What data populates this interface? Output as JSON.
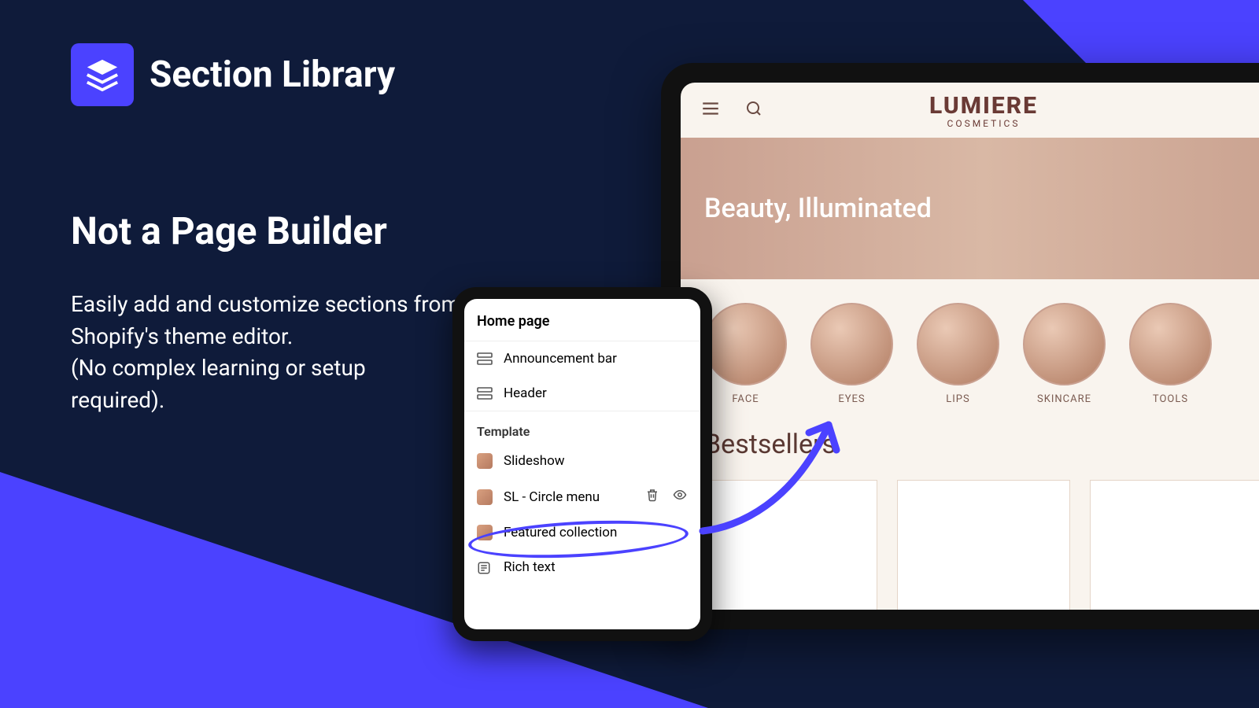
{
  "brand": {
    "title": "Section Library"
  },
  "heading": "Not a Page Builder",
  "description": "Easily add and customize sections from Shopify's theme editor.\n(No complex learning or setup required).",
  "siteMock": {
    "logoMain": "LUMIERE",
    "logoSub": "COSMETICS",
    "heroText": "Beauty, Illuminated",
    "bestsellers": "Bestsellers",
    "categories": [
      {
        "label": "FACE"
      },
      {
        "label": "EYES"
      },
      {
        "label": "LIPS"
      },
      {
        "label": "SKINCARE"
      },
      {
        "label": "TOOLS"
      }
    ]
  },
  "panel": {
    "title": "Home page",
    "announcement": "Announcement bar",
    "header": "Header",
    "templateHeading": "Template",
    "items": {
      "slideshow": "Slideshow",
      "circleMenu": "SL - Circle menu",
      "featured": "Featured collection",
      "richText": "Rich text"
    }
  },
  "colors": {
    "accent": "#4b42ff"
  }
}
